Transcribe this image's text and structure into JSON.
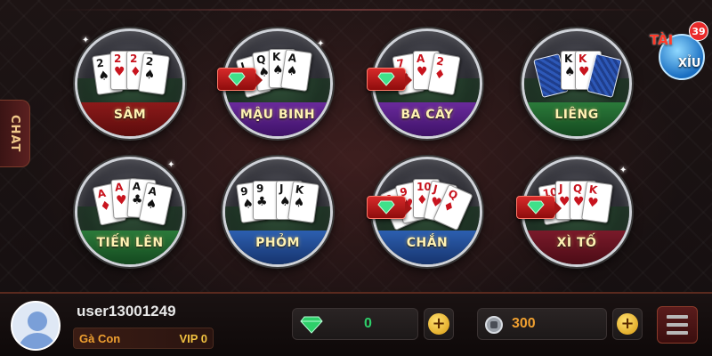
{
  "chat_tab": {
    "label": "CHAT"
  },
  "games": [
    {
      "label": "SÂM",
      "ribbon": "red"
    },
    {
      "label": "MẬU BINH",
      "ribbon": "purple"
    },
    {
      "label": "BA CÂY",
      "ribbon": "purple"
    },
    {
      "label": "LIÊNG",
      "ribbon": "green"
    },
    {
      "label": "TIẾN LÊN",
      "ribbon": "green"
    },
    {
      "label": "PHỎM",
      "ribbon": "blue"
    },
    {
      "label": "CHẮN",
      "ribbon": "blue"
    },
    {
      "label": "XÌ TỐ",
      "ribbon": "maroon"
    }
  ],
  "tai_xiu": {
    "tai": "TÀI",
    "xiu": "XỈU",
    "count": "39"
  },
  "user": {
    "name": "user13001249",
    "rank": "Gà Con",
    "vip": "VIP 0"
  },
  "wallet": {
    "gems": "0",
    "coins": "300"
  },
  "colors": {
    "gem": "#2ecf6a",
    "coins": "#f0a030",
    "plus": "#ffd040"
  },
  "icons": [
    "diamond-icon",
    "coin-icon",
    "plus-icon",
    "menu-icon",
    "avatar-icon"
  ]
}
